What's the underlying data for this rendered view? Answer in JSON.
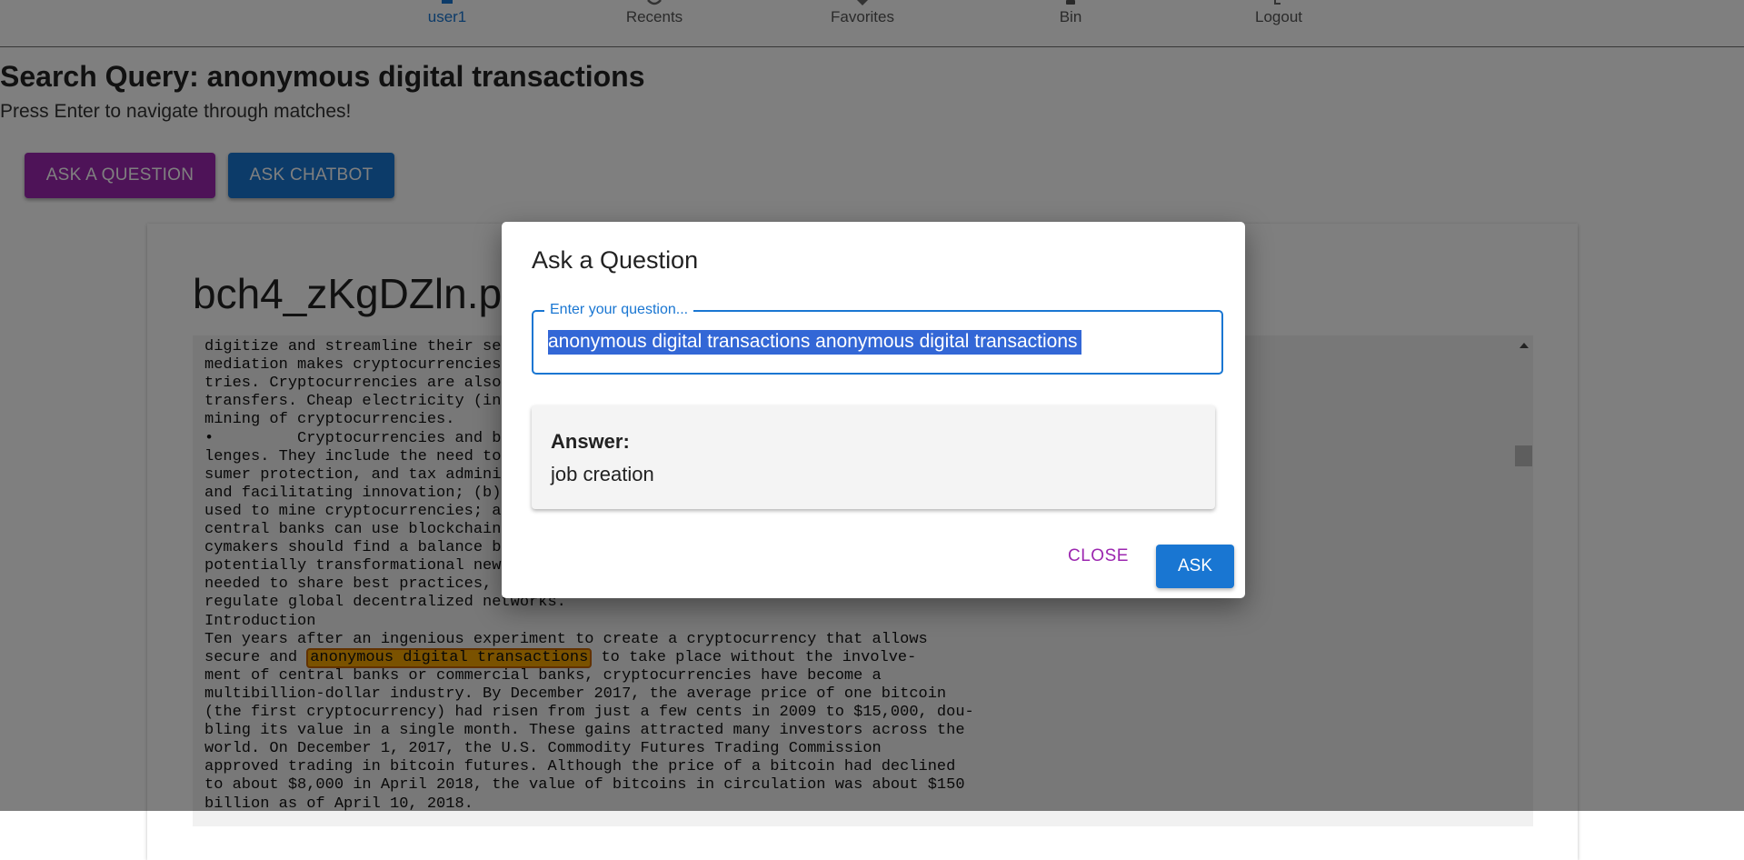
{
  "nav": {
    "items": [
      {
        "label": "user1",
        "icon": "user-icon",
        "active": true
      },
      {
        "label": "Recents",
        "icon": "clock-icon",
        "active": false
      },
      {
        "label": "Favorites",
        "icon": "heart-icon",
        "active": false
      },
      {
        "label": "Bin",
        "icon": "trash-icon",
        "active": false
      },
      {
        "label": "Logout",
        "icon": "logout-icon",
        "active": false
      }
    ]
  },
  "header": {
    "title": "Search Query: anonymous digital transactions",
    "subtitle": "Press Enter to navigate through matches!",
    "ask_question_label": "ASK A QUESTION",
    "ask_chatbot_label": "ASK CHATBOT"
  },
  "document": {
    "name": "bch4_zKgDZln.p",
    "lines": [
      {
        "text": "digitize and streamline their serv"
      },
      {
        "text": "mediation makes cryptocurrencies a"
      },
      {
        "text": "tries. Cryptocurrencies are also u"
      },
      {
        "text": "transfers. Cheap electricity (in I"
      },
      {
        "text": "mining of cryptocurrencies."
      },
      {
        "text": "•         Cryptocurrencies and bloc"
      },
      {
        "text": "lenges. They include the need to ("
      },
      {
        "text": "sumer protection, and tax administ"
      },
      {
        "text": "and facilitating innovation; (b) c"
      },
      {
        "text": "used to mine cryptocurrencies; and"
      },
      {
        "text": "central banks can use blockchain t"
      },
      {
        "text": "cymakers should find a balance bet"
      },
      {
        "text": "potentially transformational new c"
      },
      {
        "text": "needed to share best practices, av"
      },
      {
        "text": "regulate global decentralized networks."
      },
      {
        "text": "Introduction"
      },
      {
        "text": "Ten years after an ingenious experiment to create a cryptocurrency that allows"
      },
      {
        "before": "secure and ",
        "highlight": "anonymous digital transactions",
        "after": " to take place without the involve-"
      },
      {
        "text": "ment of central banks or commercial banks, cryptocurrencies have become a"
      },
      {
        "text": "multibillion-dollar industry. By December 2017, the average price of one bitcoin"
      },
      {
        "text": "(the first cryptocurrency) had risen from just a few cents in 2009 to $15,000, dou-"
      },
      {
        "text": "bling its value in a single month. These gains attracted many investors across the"
      },
      {
        "text": "world. On December 1, 2017, the U.S. Commodity Futures Trading Commission"
      },
      {
        "text": "approved trading in bitcoin futures. Although the price of a bitcoin had declined"
      },
      {
        "text": "to about $8,000 in April 2018, the value of bitcoins in circulation was about $150"
      },
      {
        "text": "billion as of April 10, 2018."
      }
    ]
  },
  "modal": {
    "title": "Ask a Question",
    "input_label": "Enter your question...",
    "input_value": "anonymous digital transactions anonymous digital transactions",
    "answer_label": "Answer:",
    "answer_text": "job creation",
    "close_label": "CLOSE",
    "ask_label": "ASK"
  },
  "colors": {
    "primary": "#1976d2",
    "secondary": "#9c27b0",
    "highlight": "#f5a500",
    "selection": "#3367d6"
  }
}
